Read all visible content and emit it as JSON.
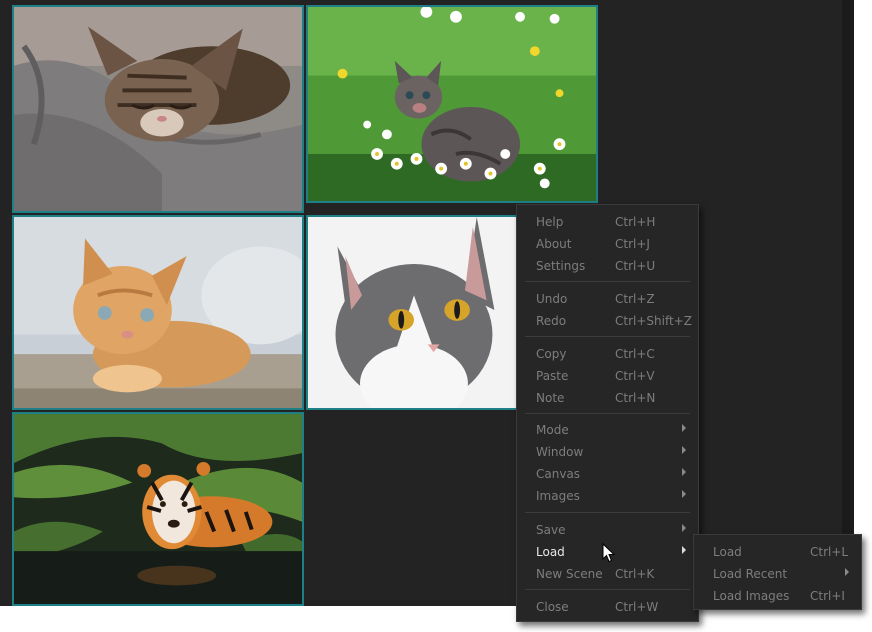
{
  "menu": {
    "items": [
      {
        "label": "Help",
        "shortcut": "Ctrl+H",
        "submenu": false
      },
      {
        "label": "About",
        "shortcut": "Ctrl+J",
        "submenu": false
      },
      {
        "label": "Settings",
        "shortcut": "Ctrl+U",
        "submenu": false
      },
      {
        "label": "Undo",
        "shortcut": "Ctrl+Z",
        "submenu": false
      },
      {
        "label": "Redo",
        "shortcut": "Ctrl+Shift+Z",
        "submenu": false
      },
      {
        "label": "Copy",
        "shortcut": "Ctrl+C",
        "submenu": false
      },
      {
        "label": "Paste",
        "shortcut": "Ctrl+V",
        "submenu": false
      },
      {
        "label": "Note",
        "shortcut": "Ctrl+N",
        "submenu": false
      },
      {
        "label": "Mode",
        "shortcut": "",
        "submenu": true
      },
      {
        "label": "Window",
        "shortcut": "",
        "submenu": true
      },
      {
        "label": "Canvas",
        "shortcut": "",
        "submenu": true
      },
      {
        "label": "Images",
        "shortcut": "",
        "submenu": true
      },
      {
        "label": "Save",
        "shortcut": "",
        "submenu": true
      },
      {
        "label": "Load",
        "shortcut": "",
        "submenu": true,
        "active": true
      },
      {
        "label": "New Scene",
        "shortcut": "Ctrl+K",
        "submenu": false
      },
      {
        "label": "Close",
        "shortcut": "Ctrl+W",
        "submenu": false
      }
    ]
  },
  "submenu": {
    "items": [
      {
        "label": "Load",
        "shortcut": "Ctrl+L",
        "submenu": false
      },
      {
        "label": "Load Recent",
        "shortcut": "",
        "submenu": true
      },
      {
        "label": "Load Images",
        "shortcut": "Ctrl+I",
        "submenu": false
      }
    ]
  },
  "images": [
    {
      "name": "kitten-sleeping-on-blanket"
    },
    {
      "name": "kitten-in-daisies"
    },
    {
      "name": "orange-kitten"
    },
    {
      "name": "gray-white-cat"
    },
    {
      "name": "tiger-swimming"
    }
  ],
  "colors": {
    "canvas": "#232323",
    "tile_border": "#1f7f86",
    "menu_bg": "#262626",
    "menu_text": "#7d7d7d",
    "menu_text_active": "#e6e6e6"
  }
}
